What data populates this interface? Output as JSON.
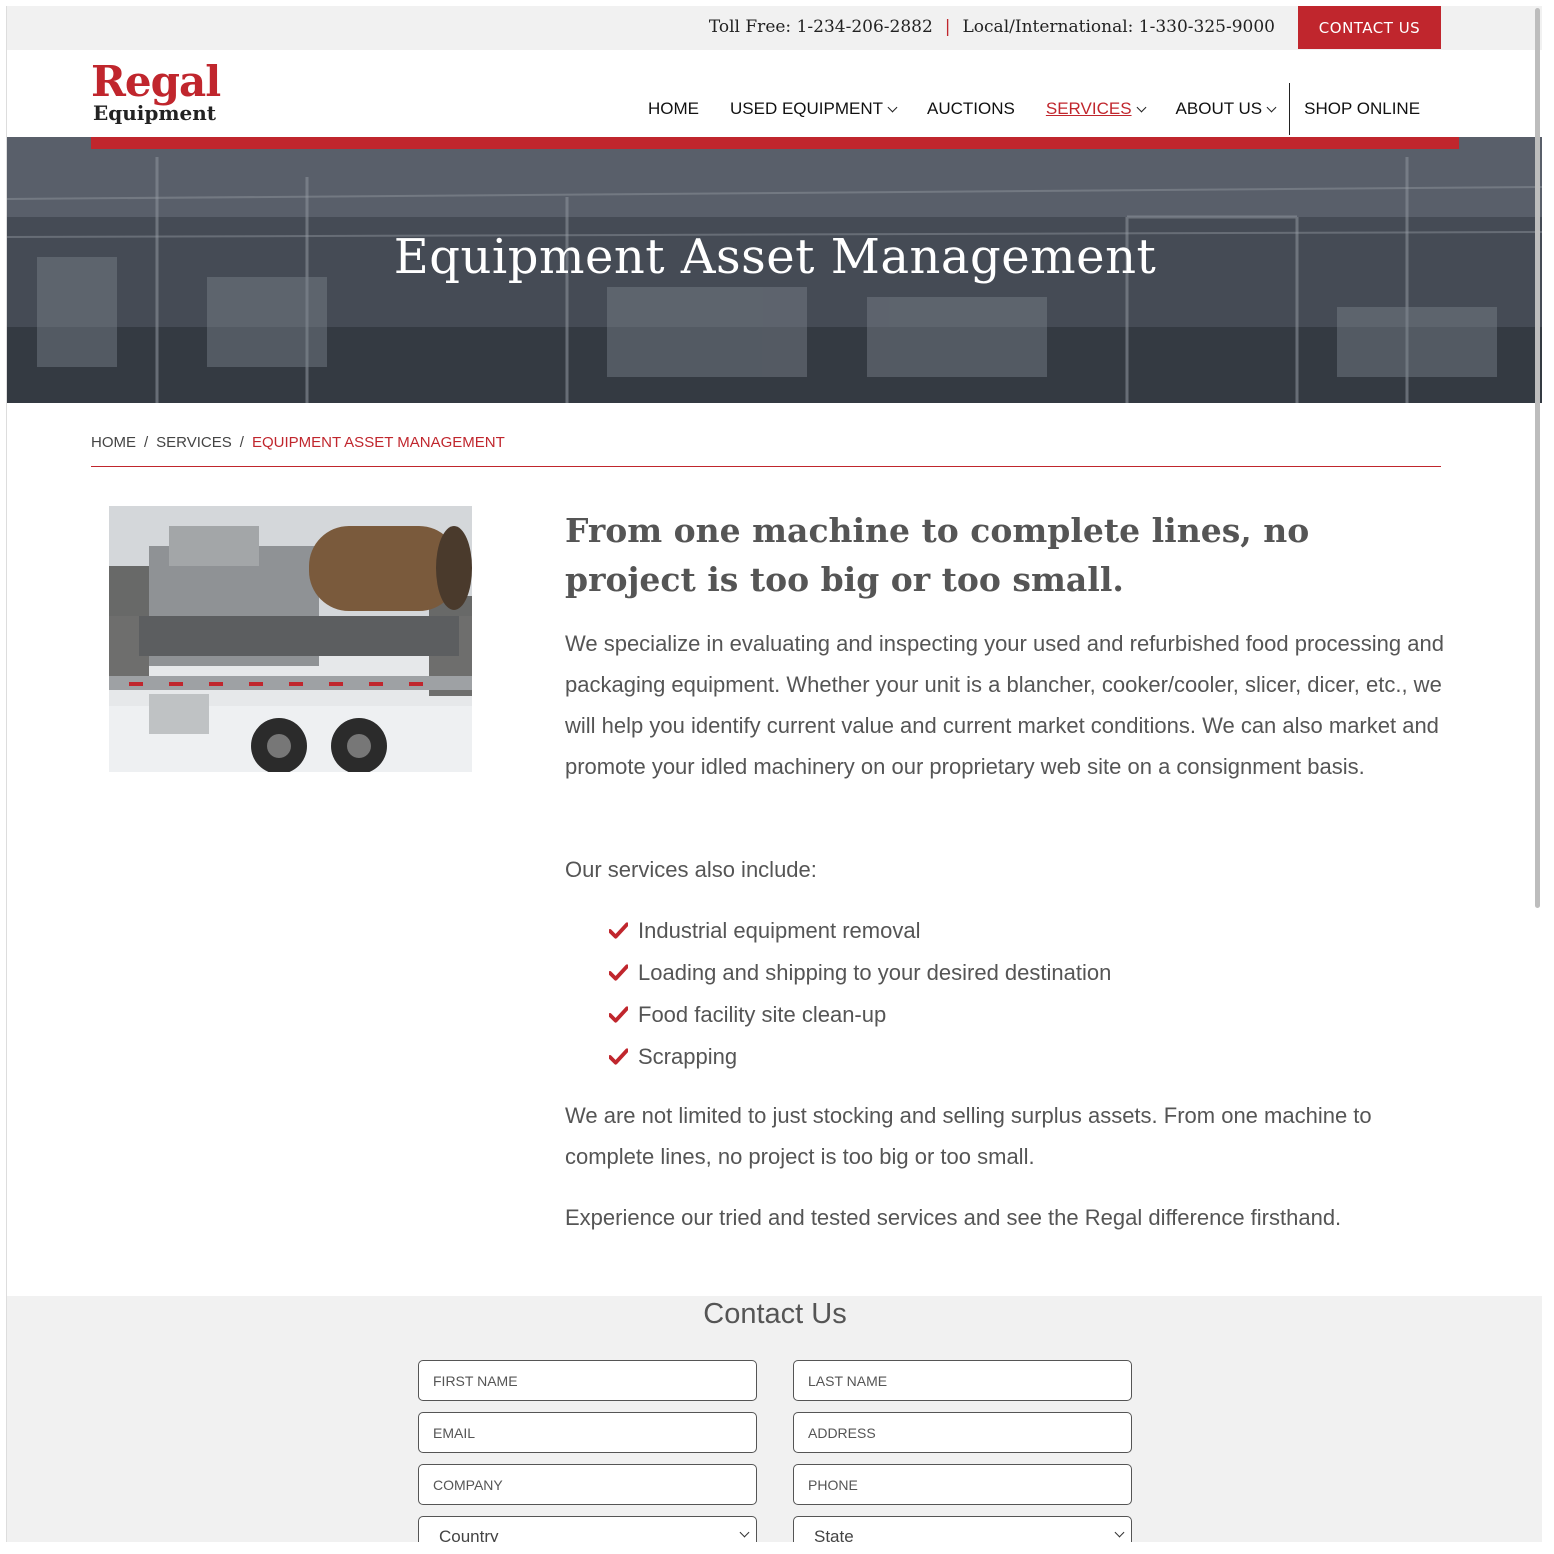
{
  "topbar": {
    "toll_free": "Toll Free: 1-234-206-2882",
    "separator": "|",
    "local": "Local/International: 1-330-325-9000",
    "contact_button": "CONTACT US"
  },
  "logo": {
    "line1": "Regal",
    "line2": "Equipment"
  },
  "nav": {
    "items": [
      {
        "label": "HOME",
        "dropdown": false
      },
      {
        "label": "USED EQUIPMENT",
        "dropdown": true
      },
      {
        "label": "AUCTIONS",
        "dropdown": false
      },
      {
        "label": "SERVICES",
        "dropdown": true,
        "active": true
      },
      {
        "label": "ABOUT US",
        "dropdown": true
      },
      {
        "label": "SHOP ONLINE",
        "dropdown": false
      }
    ]
  },
  "hero": {
    "title": "Equipment Asset Management"
  },
  "breadcrumb": {
    "items": [
      "HOME",
      "SERVICES",
      "EQUIPMENT ASSET MANAGEMENT"
    ],
    "separator": "/"
  },
  "content": {
    "heading": "From one machine to complete lines, no project is too big or too small.",
    "paragraph1": "We specialize in evaluating and inspecting your used and refurbished food processing and packaging equipment. Whether your unit is a blancher, cooker/cooler, slicer, dicer, etc., we will help you identify current value and current market conditions. We can also market and promote your idled machinery on our proprietary web site on a consignment basis.",
    "paragraph2": "Our services also include:",
    "services": [
      "Industrial equipment removal",
      "Loading and shipping to your desired destination",
      "Food facility site clean-up",
      "Scrapping"
    ],
    "paragraph3": "We are not limited to just stocking and selling surplus assets. From one machine to complete lines, no project is too big or too small.",
    "paragraph4": "Experience our tried and tested services and see the Regal difference firsthand."
  },
  "contact": {
    "title": "Contact Us",
    "placeholders": {
      "first_name": "FIRST NAME",
      "last_name": "LAST NAME",
      "email": "EMAIL",
      "address": "ADDRESS",
      "company": "COMPANY",
      "phone": "PHONE"
    },
    "country": "Country",
    "state": "State"
  },
  "colors": {
    "brand_red": "#c0262d",
    "text": "#555555",
    "topbar_bg": "#f1f1f1"
  }
}
